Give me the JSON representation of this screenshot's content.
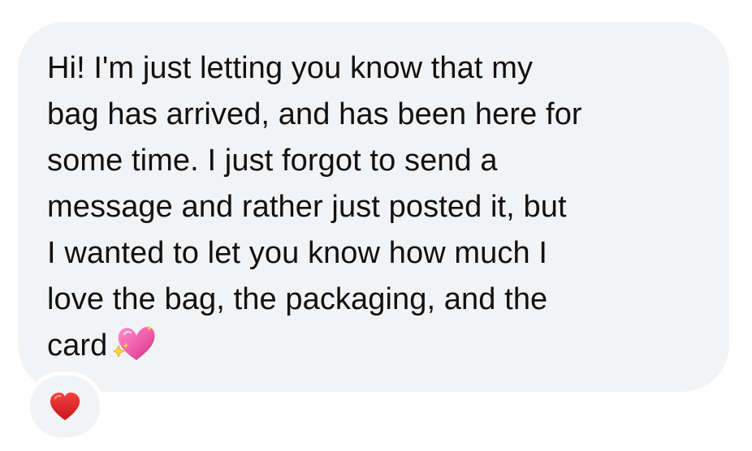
{
  "message": {
    "lines": [
      "Hi! I'm just letting you know that my",
      "bag has arrived, and has been here for",
      "some time. I just forgot to send a",
      "message and rather just posted it, but",
      "I wanted to let you know how much I",
      "love the bag, the packaging, and the",
      "card"
    ],
    "trailing_emoji": "sparkling-heart-icon"
  },
  "reaction": {
    "icon": "red-heart-icon"
  },
  "colors": {
    "bubble_bg": "#f2f3f5",
    "text": "#111111",
    "heart_red": "#e0242d",
    "sparkle_heart_pink": "#f05aa8"
  }
}
